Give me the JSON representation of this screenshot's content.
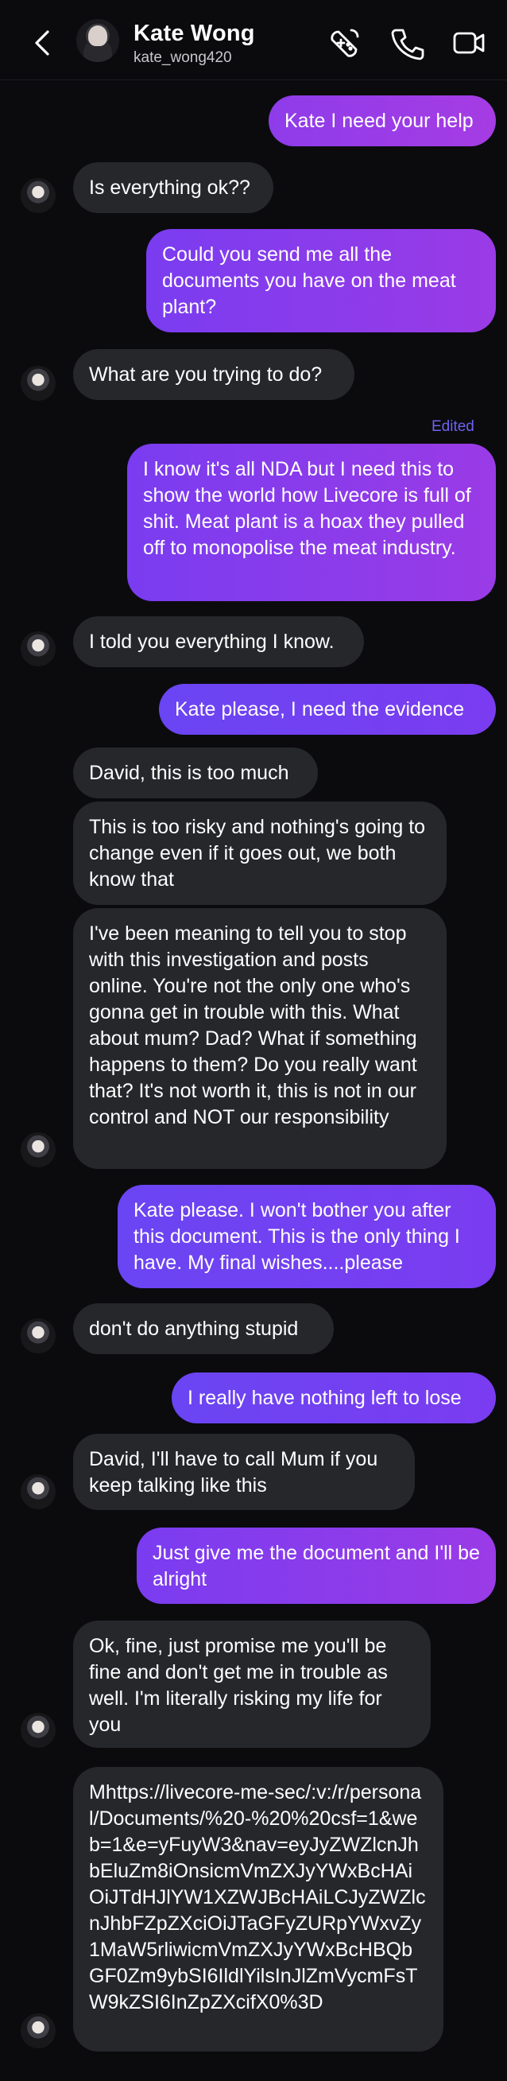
{
  "header": {
    "name": "Kate Wong",
    "username": "kate_wong420",
    "icons": [
      "back-chevron-icon",
      "game-controller-icon",
      "phone-icon",
      "video-camera-icon"
    ]
  },
  "colors": {
    "background": "#0b0b0e",
    "received_bubble": "#26272b",
    "sent_bubble_start": "#7a3cf0",
    "sent_bubble_end": "#9a3be6",
    "edited_label": "#6d63f0"
  },
  "messages": [
    {
      "from": "me",
      "text": "Kate I need your help"
    },
    {
      "from": "them",
      "text": "Is everything ok??"
    },
    {
      "from": "me",
      "text": "Could you send me all the documents you have on the meat plant?"
    },
    {
      "from": "them",
      "text": "What are you trying to do?"
    },
    {
      "from": "me",
      "edited_label": "Edited",
      "text": "I know it's all NDA but I need this to show the world how Livecore is full of shit. Meat plant is a hoax they pulled off to monopolise the meat industry."
    },
    {
      "from": "them",
      "text": "I told you everything I know."
    },
    {
      "from": "me",
      "text": "Kate please, I need the evidence"
    },
    {
      "from": "them",
      "text": "David, this is too much"
    },
    {
      "from": "them",
      "text": "This is too risky and nothing's going to change even if it goes out, we both know that"
    },
    {
      "from": "them",
      "text": "I've been meaning to tell you to stop with this investigation and posts online. You're not the only one who's gonna get in trouble with this. What about mum? Dad? What if something happens to them? Do you really want that? It's not worth it, this is not in our control and NOT our responsibility"
    },
    {
      "from": "me",
      "text": "Kate please. I won't bother you after this document. This is the only thing I have. My final wishes....please"
    },
    {
      "from": "them",
      "text": "don't do anything stupid"
    },
    {
      "from": "me",
      "text": "I really have nothing left to lose"
    },
    {
      "from": "them",
      "text": "David, I'll have to call Mum if you keep talking like this"
    },
    {
      "from": "me",
      "text": "Just give me the document and I'll be alright"
    },
    {
      "from": "them",
      "text": "Ok, fine, just promise me you'll be fine and don't get me in trouble as well. I'm literally risking my life for you"
    },
    {
      "from": "them",
      "text": "Mhttps://livecore-me-sec/:v:/r/personal/Documents/%20-%20%20csf=1&web=1&e=yFuyW3&nav=eyJyZWZlcnJhbEluZm8iOnsicmVmZXJyYWxBcHAiOiJTdHJlYW1XZWJBcHAiLCJyZWZlcnJhbFZpZXciOiJTaGFyZURpYWxvZy1MaW5rliwicmVmZXJyYWxBcHBQbGF0Zm9ybSI6IldlYilsInJlZmVycmFsTW9kZSI6InZpZXcifX0%3D"
    }
  ]
}
